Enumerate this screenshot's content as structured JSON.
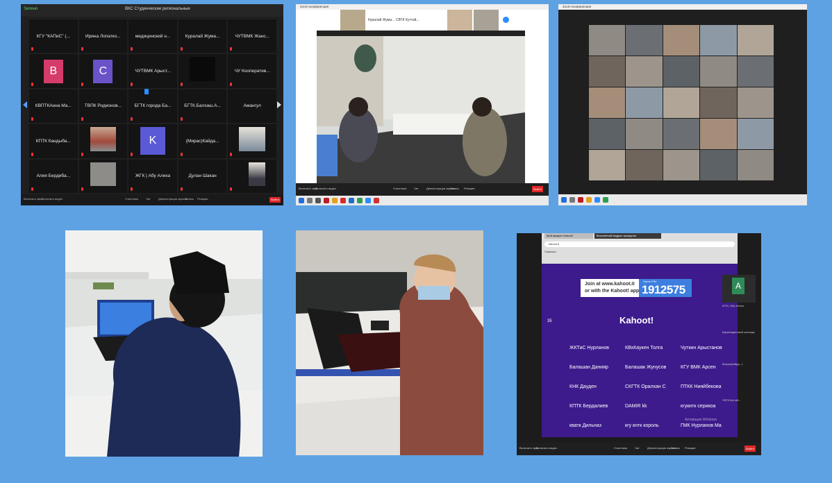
{
  "panel1": {
    "title": "ВКС Студенческие региональные",
    "security": "Зелено",
    "tiles": [
      "КГУ \"КАПиС\" (...",
      "Ирина Лопатко...",
      "медицинский н...",
      "Куралай Жума...",
      "ЧУТВМК Жанс...",
      "",
      "",
      "ЧУТВМК Арыст...",
      "",
      "ЧУ Кооператив...",
      "КВПТКАнна Ма...",
      "ТВПК Родионов...",
      "БГТК города Ба...",
      "БГТК.Балхаш.А...",
      "Амангул",
      "КПТК Кандыба...",
      "",
      "",
      "(Мирас)Кайда...",
      "",
      "Алия Бердиба...",
      "",
      "ЖГК | Абу Алиха",
      "Дулан Шакан",
      ""
    ],
    "avatars": {
      "b": "B",
      "c": "C",
      "k": "K"
    },
    "controls": [
      "Включить звук",
      "Включить видео",
      "Участники",
      "Чат",
      "Демонстрация экрана",
      "Запись",
      "Реакции"
    ],
    "end": "Выйти"
  },
  "panel2": {
    "title": "Zoom-конференция",
    "strip_labels": [
      "Куралай Жума...",
      "СВТК Куттай..."
    ],
    "controls": [
      "Включить звук",
      "Включить видео",
      "Участники",
      "Чат",
      "Демонстрация экрана",
      "Запись",
      "Реакции"
    ],
    "end": "Выйти"
  },
  "panel3": {
    "title": "Zoom-конференция"
  },
  "panel6": {
    "tab1": "Мой аккаунт Kahoot!",
    "tab2": "Встроенный модуль прокрутки",
    "address": "kahoot.it",
    "bookmark": "Сервисы",
    "join_line1": "Join at www.kahoot.it",
    "join_line2": "or with the Kahoot! app",
    "pin_label": "Game PIN:",
    "pin": "1912575",
    "count": "35",
    "logo": "Kahoot!",
    "names": [
      "ЖКТиС Нурланов",
      "КВхКаукен Толга",
      "Чуткин Арыстанов",
      "Балашан Данияр",
      "Балашак Жунусов",
      "КГУ ВМК Арсен",
      "КНК Дауден",
      "СКГТК Оралхан С",
      "ПТКК Нияйбекова",
      "КПТК Бердалиев",
      "DAMIR kk",
      "кгукитк серикоа",
      "кватк Дильназ",
      "кгу кнтк король",
      "ГМК Нурланов Ма"
    ],
    "side_avatar": "A",
    "side_captions": [
      "ЖГК | Абу Алиха",
      "Карагандинский колледж",
      "Мирас(Кайда...)",
      "СВТК Куттай..."
    ],
    "watermark": "Активация Windows",
    "controls": [
      "Включить звук",
      "Включить видео",
      "Участники",
      "Чат",
      "Демонстрация экрана",
      "Запись",
      "Реакции"
    ],
    "end": "Выйти"
  }
}
